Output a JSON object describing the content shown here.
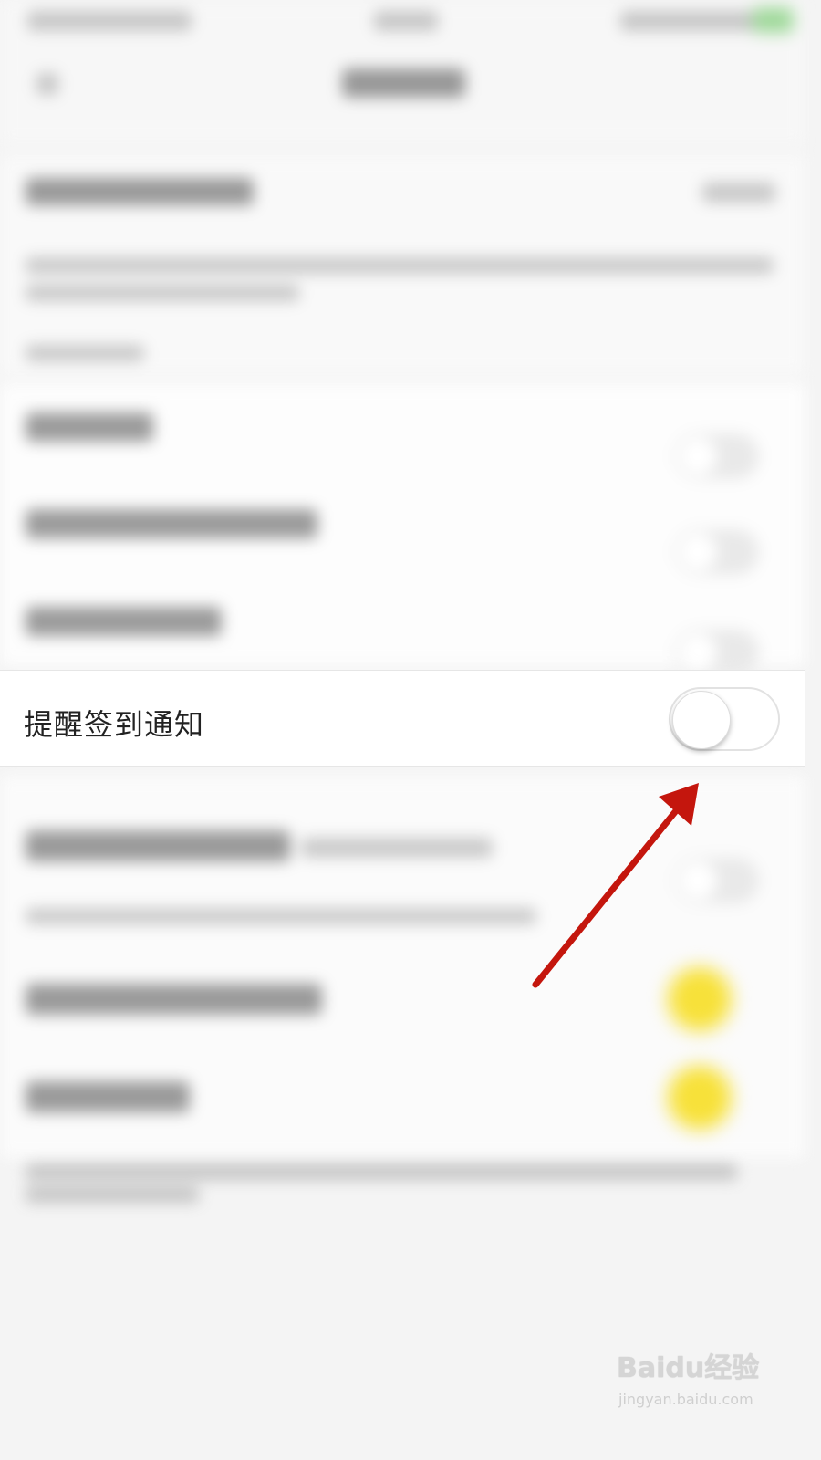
{
  "focused_setting": {
    "label": "提醒签到通知",
    "toggle_on": false
  },
  "watermark": {
    "logo_text": "Baidu经验",
    "url_text": "jingyan.baidu.com"
  },
  "colors": {
    "arrow": "#c4160d",
    "background": "#f4f4f4",
    "highlight_dot": "#f7e13a"
  }
}
